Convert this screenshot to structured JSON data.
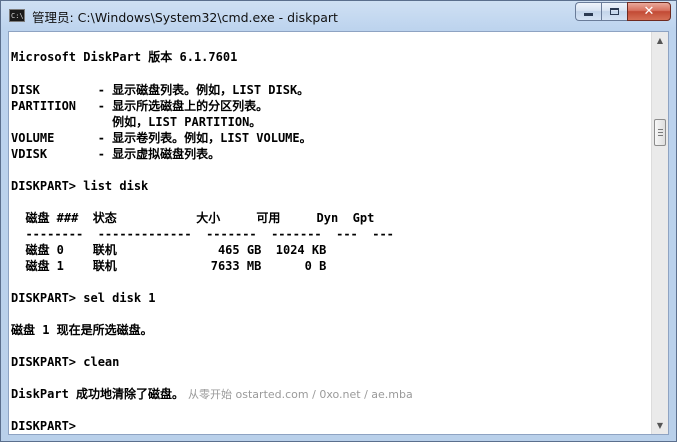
{
  "window": {
    "title": "管理员: C:\\Windows\\System32\\cmd.exe - diskpart",
    "icon_label": "C:\\"
  },
  "controls": {
    "minimize_icon": "minimize-icon",
    "maximize_icon": "maximize-icon",
    "close_glyph": "✕"
  },
  "console": {
    "lines": [
      "Microsoft DiskPart 版本 6.1.7601",
      "DISK        - 显示磁盘列表。例如，LIST DISK。",
      "PARTITION   - 显示所选磁盘上的分区列表。",
      "              例如，LIST PARTITION。",
      "VOLUME      - 显示卷列表。例如，LIST VOLUME。",
      "VDISK       - 显示虚拟磁盘列表。",
      "DISKPART> list disk",
      "  磁盘 ###  状态           大小     可用     Dyn  Gpt",
      "  --------  -------------  -------  -------  ---  ---",
      "  磁盘 0    联机              465 GB  1024 KB",
      "  磁盘 1    联机             7633 MB      0 B",
      "DISKPART> sel disk 1",
      "磁盘 1 现在是所选磁盘。",
      "DISKPART> clean",
      "DiskPart 成功地清除了磁盘。",
      "DISKPART>"
    ],
    "watermark": "从零开始 ostarted.com / 0xo.net / ae.mba"
  },
  "scrollbar": {
    "up_icon": "▲",
    "down_icon": "▼"
  }
}
